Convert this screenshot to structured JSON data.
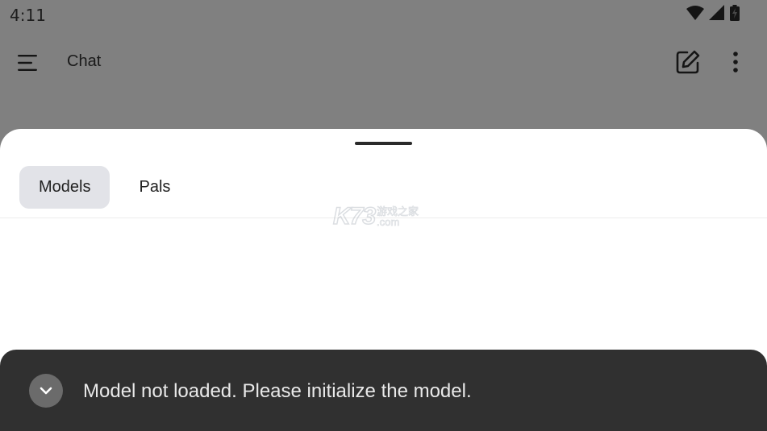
{
  "status_bar": {
    "time": "4:11",
    "icons": [
      "wifi-icon",
      "cell-signal-icon",
      "battery-icon"
    ]
  },
  "header": {
    "title": "Chat",
    "icons": [
      "menu-icon",
      "edit-icon",
      "more-vert-icon"
    ]
  },
  "sheet": {
    "tabs": [
      {
        "label": "Models",
        "active": true
      },
      {
        "label": "Pals",
        "active": false
      }
    ]
  },
  "watermark": {
    "logo": "K73",
    "cn": "游戏之家",
    "domain": ".com"
  },
  "snackbar": {
    "message": "Model not loaded. Please initialize the model.",
    "icon": "chevron-down-icon"
  },
  "colors": {
    "scrim": "#7a7a7a",
    "sheet_bg": "#ffffff",
    "active_tab_bg": "#e2e3e8",
    "snackbar_bg": "#303030",
    "snackbar_text": "#e9e9e9"
  }
}
